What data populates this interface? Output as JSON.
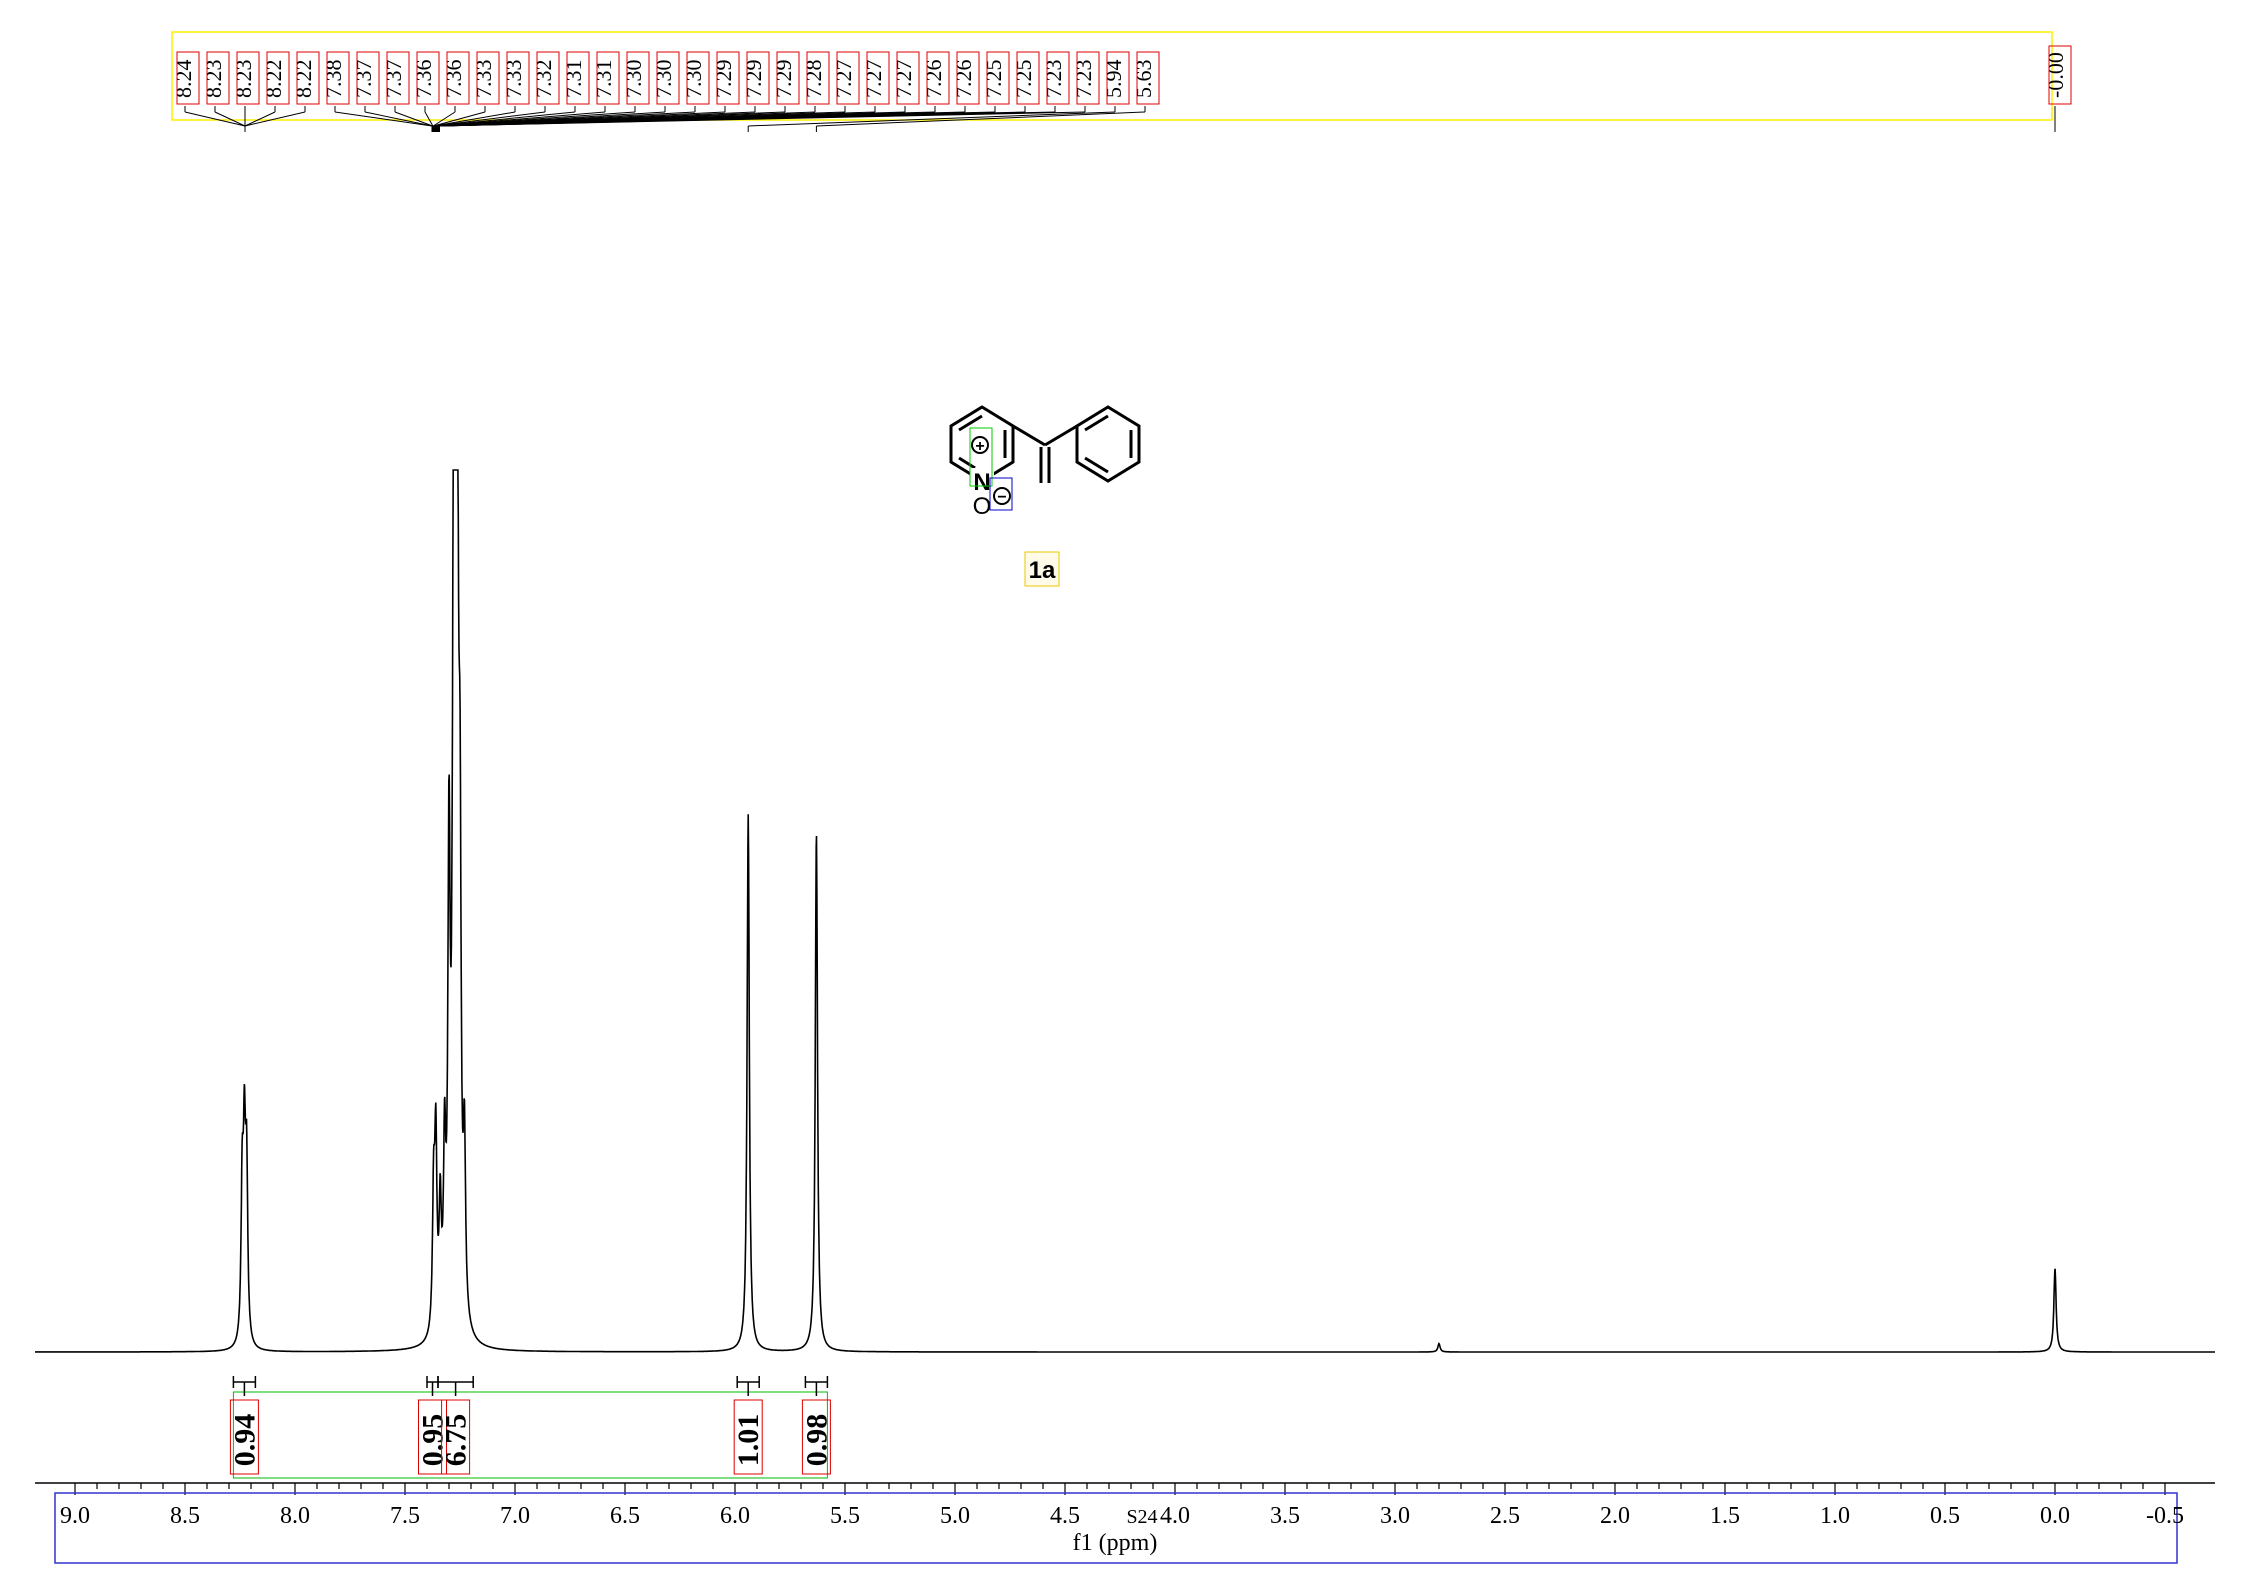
{
  "chart_data": {
    "type": "line",
    "title": "",
    "xlabel": "f1 (ppm)",
    "ylabel": "",
    "xlim": [
      9.0,
      -0.5
    ],
    "x_axis_reversed": true,
    "x_ticks": [
      "9.0",
      "8.5",
      "8.0",
      "7.5",
      "7.0",
      "6.5",
      "6.0",
      "5.5",
      "5.0",
      "4.5",
      "4.0",
      "3.5",
      "3.0",
      "2.5",
      "2.0",
      "1.5",
      "1.0",
      "0.5",
      "0.0",
      "-0.5"
    ],
    "x_tick_values": [
      9.0,
      8.5,
      8.0,
      7.5,
      7.0,
      6.5,
      6.0,
      5.5,
      5.0,
      4.5,
      4.0,
      3.5,
      3.0,
      2.5,
      2.0,
      1.5,
      1.0,
      0.5,
      0.0,
      -0.5
    ],
    "axis_note": "S24",
    "axis_note_at": 4.15,
    "peak_labels": [
      "8.24",
      "8.23",
      "8.23",
      "8.22",
      "8.22",
      "7.38",
      "7.37",
      "7.37",
      "7.36",
      "7.36",
      "7.33",
      "7.33",
      "7.32",
      "7.31",
      "7.31",
      "7.30",
      "7.30",
      "7.30",
      "7.29",
      "7.29",
      "7.29",
      "7.28",
      "7.27",
      "7.27",
      "7.27",
      "7.26",
      "7.26",
      "7.25",
      "7.25",
      "7.23",
      "7.23",
      "5.94",
      "5.63"
    ],
    "tms_label": "-0.00",
    "peaks": [
      {
        "ppm": 8.24,
        "height": 0.18
      },
      {
        "ppm": 8.23,
        "height": 0.22
      },
      {
        "ppm": 8.22,
        "height": 0.2
      },
      {
        "ppm": 7.37,
        "height": 0.16
      },
      {
        "ppm": 7.36,
        "height": 0.22
      },
      {
        "ppm": 7.34,
        "height": 0.14
      },
      {
        "ppm": 7.32,
        "height": 0.2
      },
      {
        "ppm": 7.3,
        "height": 0.55
      },
      {
        "ppm": 7.28,
        "height": 0.72
      },
      {
        "ppm": 7.27,
        "height": 1.0
      },
      {
        "ppm": 7.26,
        "height": 0.62
      },
      {
        "ppm": 7.25,
        "height": 0.48
      },
      {
        "ppm": 7.23,
        "height": 0.2
      },
      {
        "ppm": 5.94,
        "height": 0.64
      },
      {
        "ppm": 5.63,
        "height": 0.62
      },
      {
        "ppm": 2.8,
        "height": 0.01
      },
      {
        "ppm": 0.0,
        "height": 0.1
      }
    ],
    "integrals": [
      {
        "from": 8.28,
        "to": 8.18,
        "value": "0.94"
      },
      {
        "from": 7.4,
        "to": 7.35,
        "value": "0.95"
      },
      {
        "from": 7.35,
        "to": 7.19,
        "value": "6.75"
      },
      {
        "from": 5.99,
        "to": 5.89,
        "value": "1.01"
      },
      {
        "from": 5.68,
        "to": 5.58,
        "value": "0.98"
      }
    ],
    "grid": false,
    "legend": "none"
  },
  "molecule": {
    "label": "1a",
    "atoms": {
      "n": "N",
      "o": "O",
      "plus": "+",
      "minus": "−"
    }
  }
}
